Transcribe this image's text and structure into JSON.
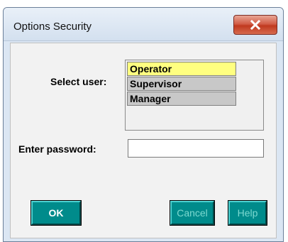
{
  "window": {
    "title": "Options Security"
  },
  "form": {
    "select_user_label": "Select user:",
    "password_label": "Enter password:",
    "password_value": ""
  },
  "users": [
    {
      "name": "Operator",
      "selected": true
    },
    {
      "name": "Supervisor",
      "selected": false
    },
    {
      "name": "Manager",
      "selected": false
    }
  ],
  "buttons": {
    "ok": "OK",
    "cancel": "Cancel",
    "help": "Help"
  },
  "colors": {
    "button_face": "#008b8b",
    "selected_item": "#ffff80",
    "close_button": "#c0391f"
  },
  "icons": {
    "close": "close-icon"
  }
}
